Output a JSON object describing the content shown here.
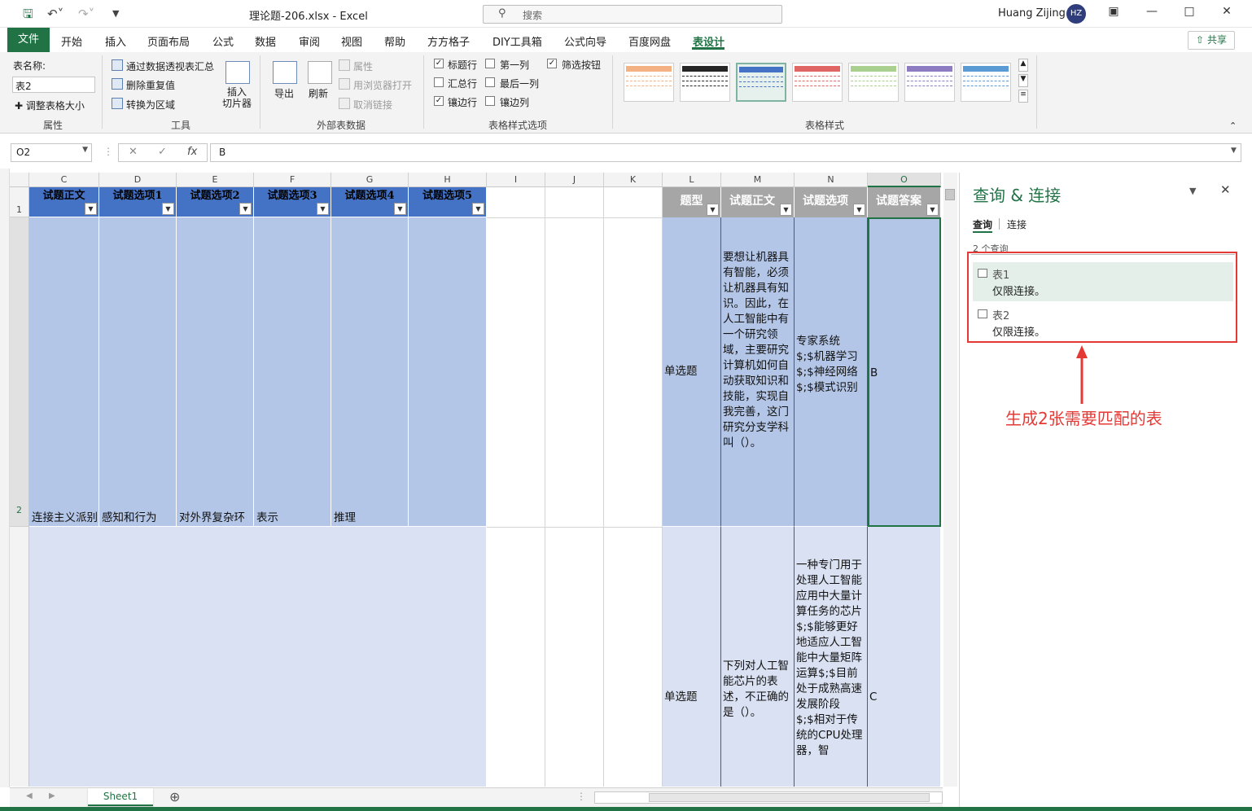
{
  "window": {
    "title": "理论题-206.xlsx  -  Excel",
    "search_placeholder": "搜索",
    "user": "Huang Zijing",
    "avatar": "HZ"
  },
  "tabs": {
    "file": "文件",
    "items": [
      "开始",
      "插入",
      "页面布局",
      "公式",
      "数据",
      "审阅",
      "视图",
      "帮助",
      "方方格子",
      "DIY工具箱",
      "公式向导",
      "百度网盘"
    ],
    "active": "表设计",
    "share": "共享"
  },
  "ribbon": {
    "props": {
      "name_label": "表名称:",
      "name_value": "表2",
      "resize": "调整表格大小",
      "group": "属性"
    },
    "tools": {
      "pivot": "通过数据透视表汇总",
      "dedupe": "删除重复值",
      "convert": "转换为区域",
      "slicer": "插入\n切片器",
      "group": "工具"
    },
    "external": {
      "export": "导出",
      "refresh": "刷新",
      "properties": "属性",
      "open_browser": "用浏览器打开",
      "unlink": "取消链接",
      "group": "外部表数据"
    },
    "options": {
      "header_row": "标题行",
      "total_row": "汇总行",
      "banded_rows": "镶边行",
      "first_col": "第一列",
      "last_col": "最后一列",
      "banded_cols": "镶边列",
      "filter_btn": "筛选按钮",
      "group": "表格样式选项"
    },
    "styles": {
      "group": "表格样式",
      "swatches": [
        "#f4b183",
        "#262626",
        "#4472c4",
        "#e06666",
        "#a9d08e",
        "#8e7cc3",
        "#5b9bd5"
      ]
    }
  },
  "formula": {
    "name_box": "O2",
    "value": "B"
  },
  "grid": {
    "columns": [
      "C",
      "D",
      "E",
      "F",
      "G",
      "H",
      "I",
      "J",
      "K",
      "L",
      "M",
      "N",
      "O"
    ],
    "rows": [
      "1",
      "2"
    ],
    "table2_headers": [
      "试题正文",
      "试题选项1",
      "试题选项2",
      "试题选项3",
      "试题选项4",
      "试题选项5"
    ],
    "row2_left": [
      "连接主义派别",
      "感知和行为",
      "对外界复杂环",
      "表示",
      "推理"
    ],
    "table1_headers": [
      "题型",
      "试题正文",
      "试题选项",
      "试题答案"
    ],
    "r2": {
      "type": "单选题",
      "text": "要想让机器具有智能，必须让机器具有知识。因此，在人工智能中有一个研究领域，主要研究计算机如何自动获取知识和技能，实现自我完善，这门研究分支学科叫（）。",
      "options": "专家系统$;$机器学习$;$神经网络$;$模式识别",
      "answer": "B"
    },
    "r3": {
      "type": "单选题",
      "text": "下列对人工智能芯片的表述，不正确的是（）。",
      "options": "一种专门用于处理人工智能应用中大量计算任务的芯片$;$能够更好地适应人工智能中大量矩阵运算$;$目前处于成熟高速发展阶段$;$相对于传统的CPU处理器，智",
      "answer": "C"
    }
  },
  "sheet_tab": "Sheet1",
  "queries": {
    "title": "查询 & 连接",
    "tab_queries": "查询",
    "tab_connections": "连接",
    "count": "2 个查询",
    "items": [
      {
        "name": "表1",
        "status": "仅限连接。"
      },
      {
        "name": "表2",
        "status": "仅限连接。"
      }
    ]
  },
  "annotation": "生成2张需要匹配的表"
}
